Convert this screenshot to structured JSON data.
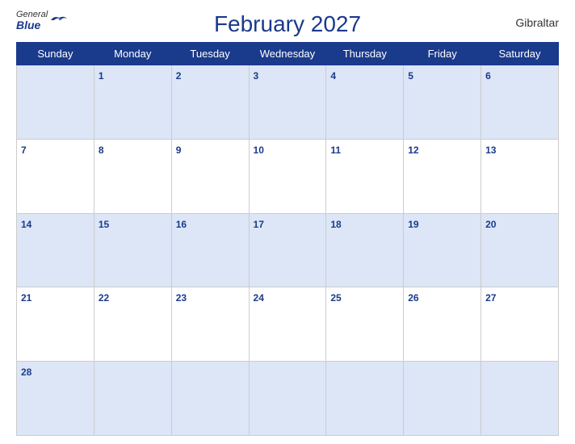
{
  "header": {
    "title": "February 2027",
    "country": "Gibraltar",
    "logo": {
      "line1": "General",
      "line2": "Blue"
    }
  },
  "weekdays": [
    "Sunday",
    "Monday",
    "Tuesday",
    "Wednesday",
    "Thursday",
    "Friday",
    "Saturday"
  ],
  "weeks": [
    [
      null,
      1,
      2,
      3,
      4,
      5,
      6
    ],
    [
      7,
      8,
      9,
      10,
      11,
      12,
      13
    ],
    [
      14,
      15,
      16,
      17,
      18,
      19,
      20
    ],
    [
      21,
      22,
      23,
      24,
      25,
      26,
      27
    ],
    [
      28,
      null,
      null,
      null,
      null,
      null,
      null
    ]
  ]
}
